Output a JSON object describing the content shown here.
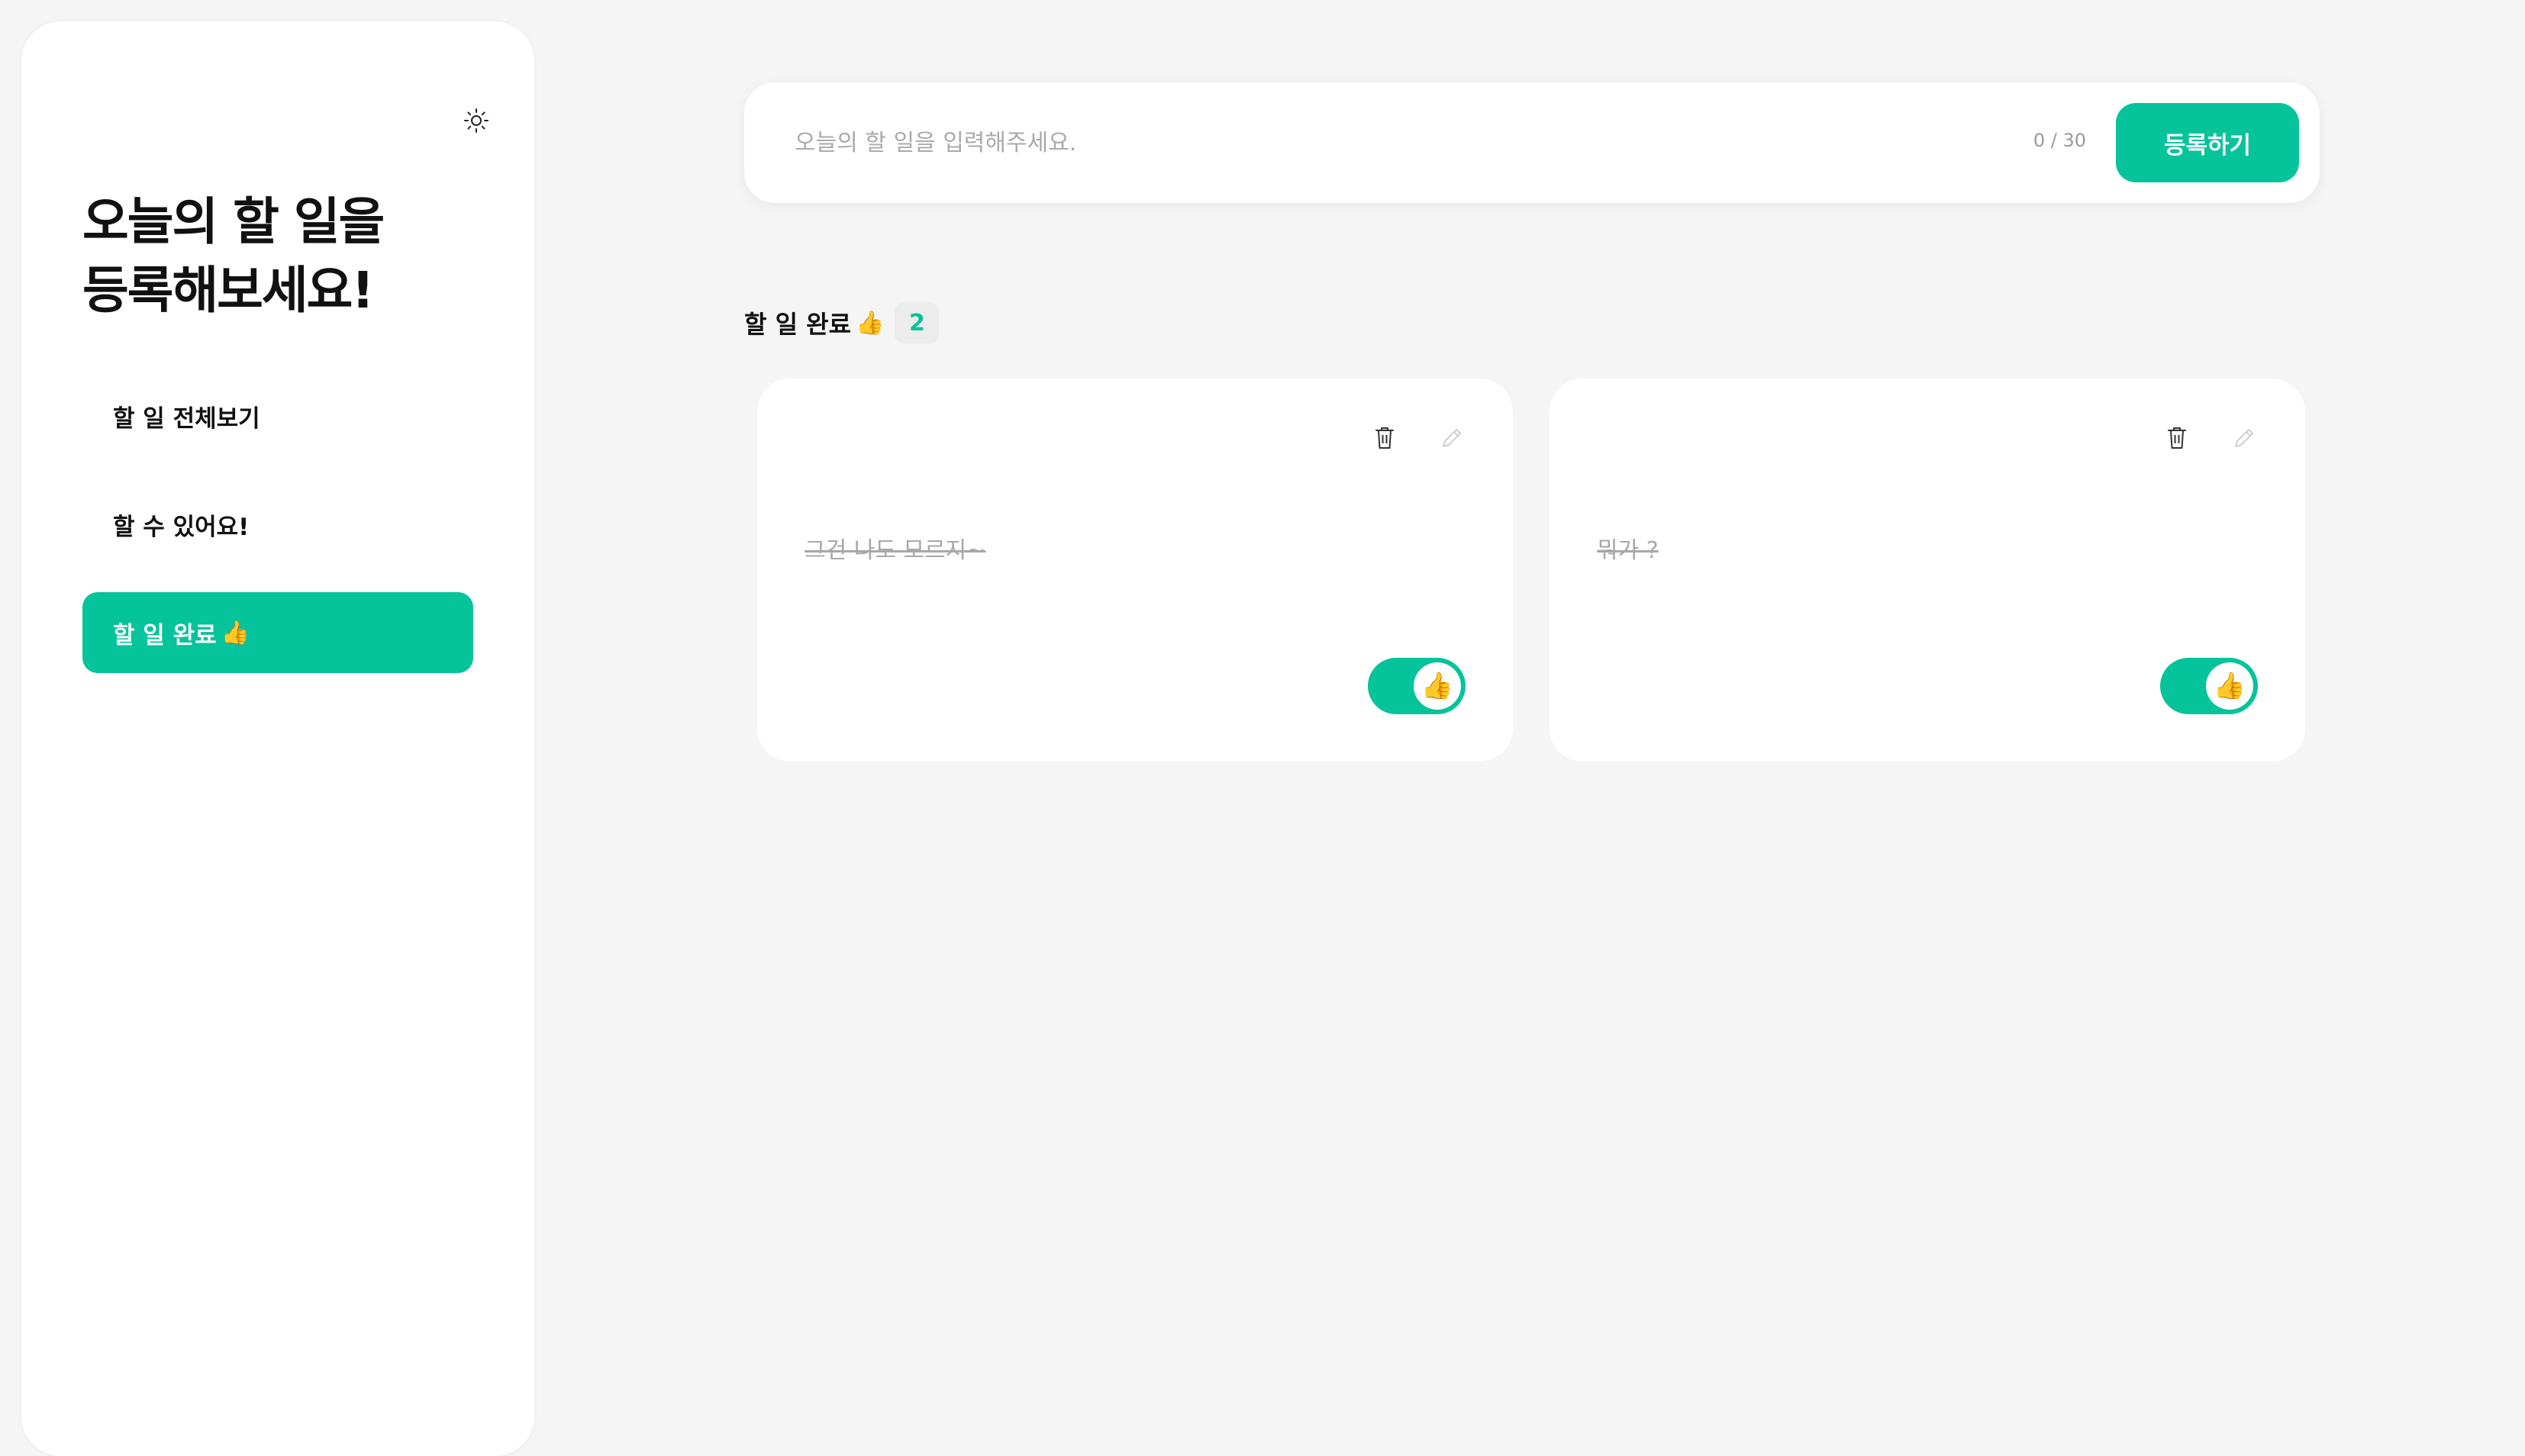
{
  "sidebar": {
    "title": "오늘의 할 일을\n등록해보세요!",
    "nav_items": [
      {
        "label": "할 일 전체보기"
      },
      {
        "label": "할 수 있어요!"
      },
      {
        "label": "할 일 완료",
        "emoji": "👍"
      }
    ],
    "active_index": 2
  },
  "input": {
    "placeholder": "오늘의 할 일을 입력해주세요.",
    "value": "",
    "char_count": "0 / 30",
    "submit_label": "등록하기"
  },
  "section": {
    "title": "할 일 완료",
    "emoji": "👍",
    "count": "2"
  },
  "todos": [
    {
      "text": "그건 나도 모르지~",
      "done": true,
      "toggle_emoji": "👍"
    },
    {
      "text": "뭐가 ?",
      "done": true,
      "toggle_emoji": "👍"
    }
  ],
  "colors": {
    "accent": "#05c39a",
    "background": "#f5f5f5",
    "card": "#ffffff",
    "muted_text": "#a8a8a8"
  },
  "icons": {
    "theme": "sun-icon",
    "delete": "trash-icon",
    "edit": "pencil-icon"
  }
}
